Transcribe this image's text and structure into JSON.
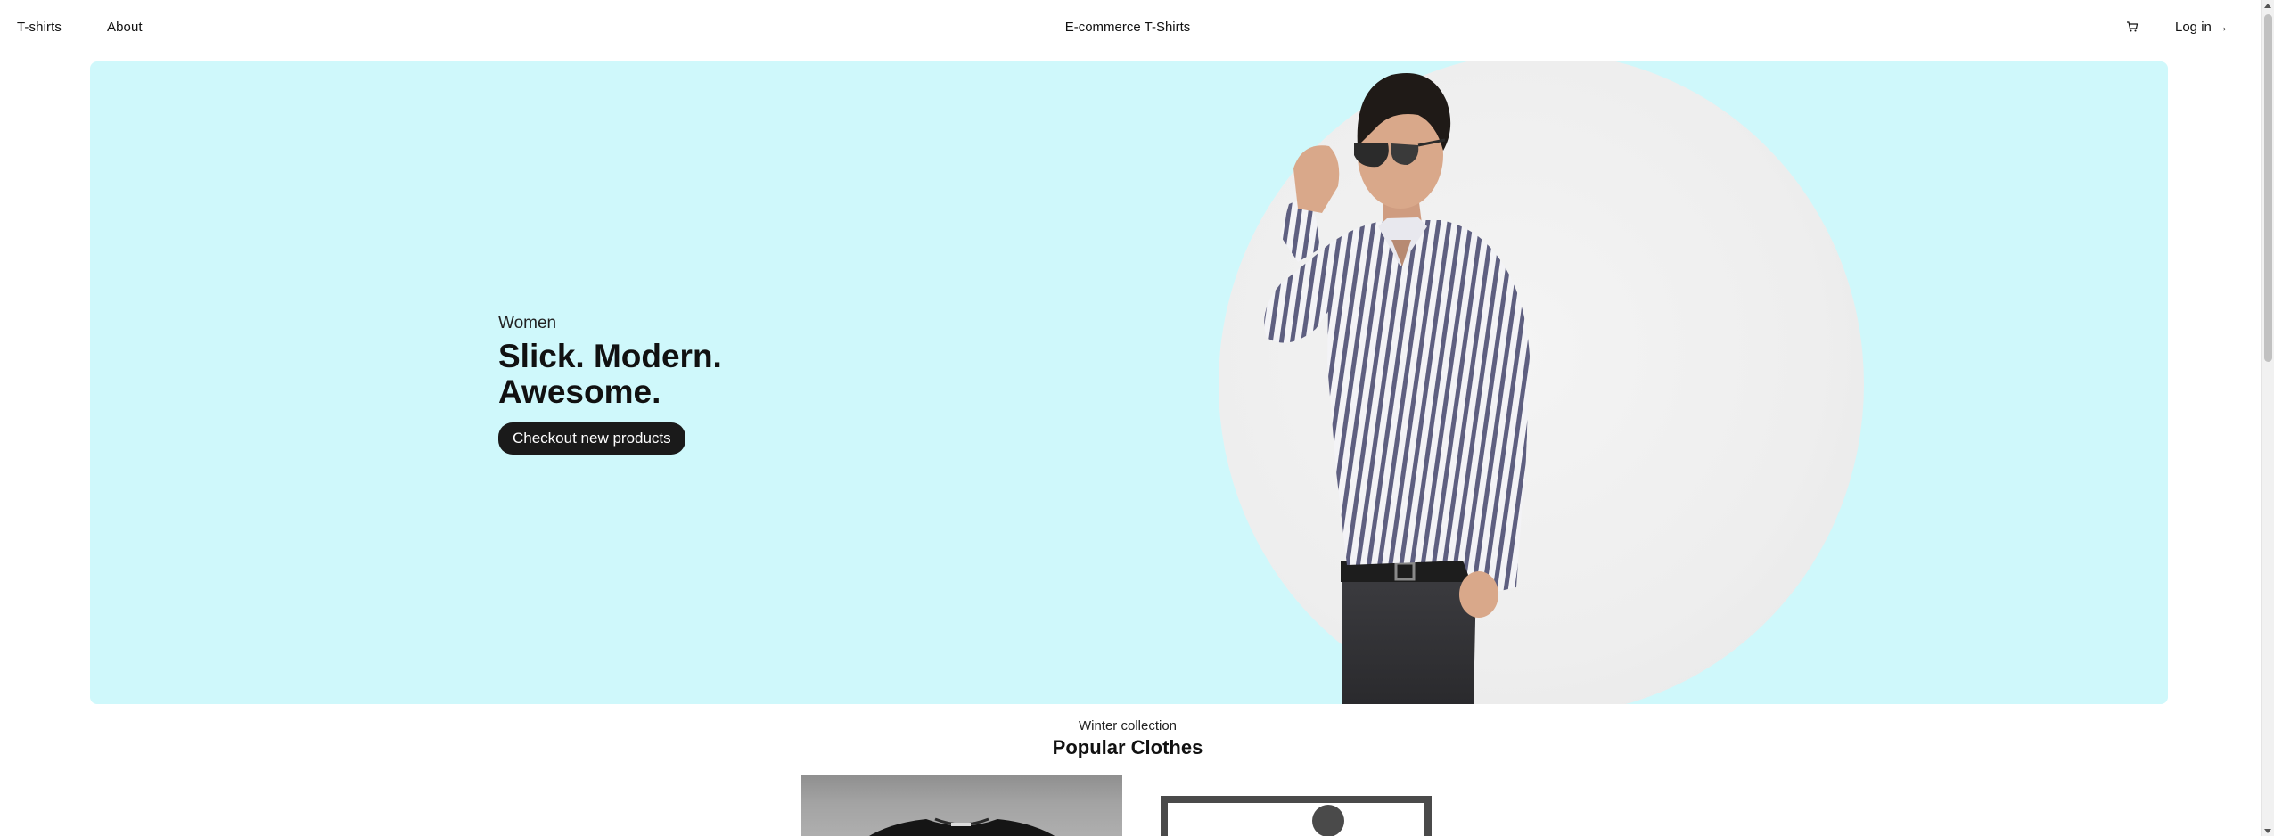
{
  "header": {
    "nav": [
      {
        "label": "T-shirts"
      },
      {
        "label": "About"
      }
    ],
    "site_title": "E-commerce T-Shirts",
    "cart_icon": "cart-icon",
    "login_label": "Log in →"
  },
  "hero": {
    "subtitle": "Women",
    "headline": "Slick. Modern. Awesome.",
    "cta_label": "Checkout new products",
    "background_color": "#cff8fb",
    "cta_color": "#1a1a1a"
  },
  "collection": {
    "subtitle": "Winter collection",
    "title": "Popular Clothes"
  }
}
